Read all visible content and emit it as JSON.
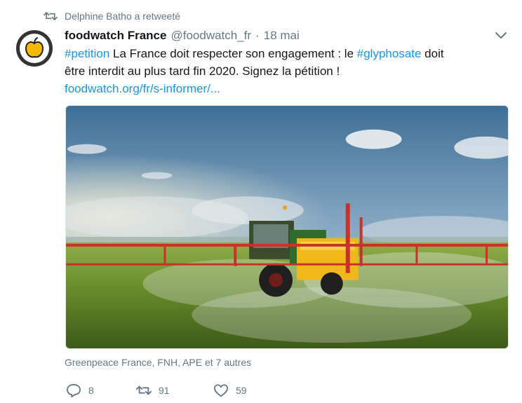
{
  "retweet": {
    "text": "Delphine Batho a retweeté",
    "icon": "retweet-icon"
  },
  "tweet": {
    "author_name": "foodwatch France",
    "handle": "@foodwatch_fr",
    "separator": "·",
    "date": "18 mai",
    "text_parts": {
      "hashtag1": "#petition",
      "text1": " La France doit respecter son engagement : le ",
      "hashtag2": "#glyphosate",
      "text2": " doit être interdit au plus tard fin 2020. Signez la pétition !",
      "link": "foodwatch.org/fr/s-informer/..."
    },
    "tagged": "Greenpeace France, FNH, APE et 7 autres",
    "reply_count": "8",
    "retweet_count": "91",
    "like_count": "59"
  },
  "colors": {
    "link": "#1b95e0",
    "muted": "#657786",
    "avatar_bg": "#333333",
    "apple": "#f6b800"
  },
  "icons": {
    "avatar": "apple-icon",
    "menu": "chevron-down-icon",
    "reply": "reply-icon",
    "retweet": "retweet-icon",
    "like": "heart-icon"
  }
}
